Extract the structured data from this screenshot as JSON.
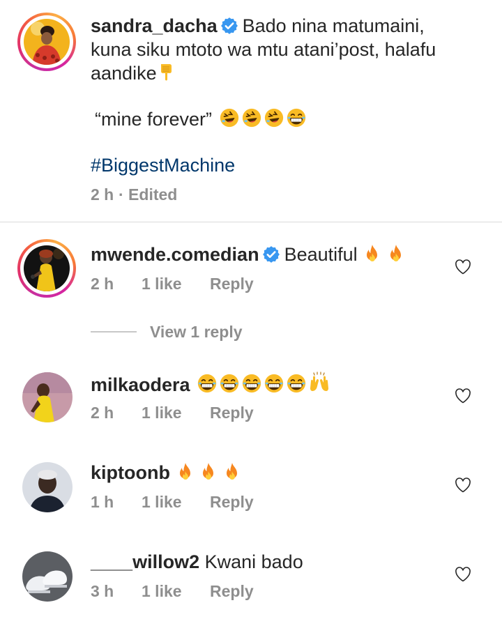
{
  "comments": [
    {
      "username": "sandra_dacha",
      "verified": true,
      "lines": [
        "Bado nina matumaini,",
        "kuna siku mtoto wa mtu atani’post, halafu",
        "aandike"
      ],
      "quote": "“mine forever”",
      "hashtag": "#BiggestMachine",
      "time": "2 h",
      "edited": "· Edited"
    },
    {
      "username": "mwende.comedian",
      "verified": true,
      "text": "Beautiful",
      "time": "2 h",
      "likes": "1 like",
      "reply": "Reply"
    },
    {
      "username": "milkaodera",
      "text": "",
      "time": "2 h",
      "likes": "1 like",
      "reply": "Reply"
    },
    {
      "username": "kiptoonb",
      "text": "",
      "time": "1 h",
      "likes": "1 like",
      "reply": "Reply"
    },
    {
      "username": "____willow2",
      "text": "Kwani bado",
      "time": "3 h",
      "likes": "1 like",
      "reply": "Reply"
    }
  ],
  "view_replies": "View 1 reply",
  "colors": {
    "verified": "#3897f0",
    "hashtag": "#00376b",
    "meta": "#8e8e8e"
  },
  "icons": [
    "verified-badge-icon",
    "heart-outline-icon",
    "fire-emoji",
    "rofl-emoji",
    "grin-emoji",
    "raised-hands-emoji",
    "point-down-emoji"
  ]
}
